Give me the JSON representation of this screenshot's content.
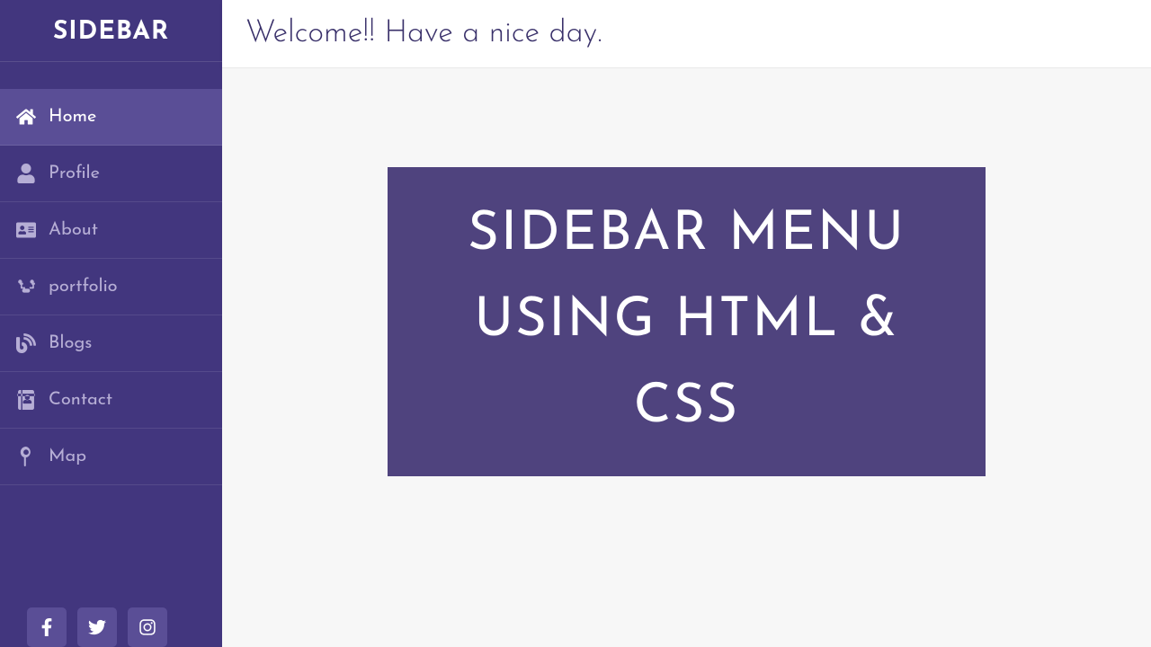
{
  "sidebar": {
    "title": "SIDEBAR",
    "items": [
      {
        "label": "Home"
      },
      {
        "label": "Profile"
      },
      {
        "label": "About"
      },
      {
        "label": "portfolio"
      },
      {
        "label": "Blogs"
      },
      {
        "label": "Contact"
      },
      {
        "label": "Map"
      }
    ],
    "active_index": 0
  },
  "topbar": {
    "welcome": "Welcome!! Have a nice day."
  },
  "main": {
    "card_text": "SIDEBAR MENU USING HTML & CSS"
  },
  "colors": {
    "sidebar_bg": "#42367e",
    "sidebar_active": "#5a4e96",
    "card_bg": "#4f437e",
    "text_muted": "#b6aed5"
  }
}
